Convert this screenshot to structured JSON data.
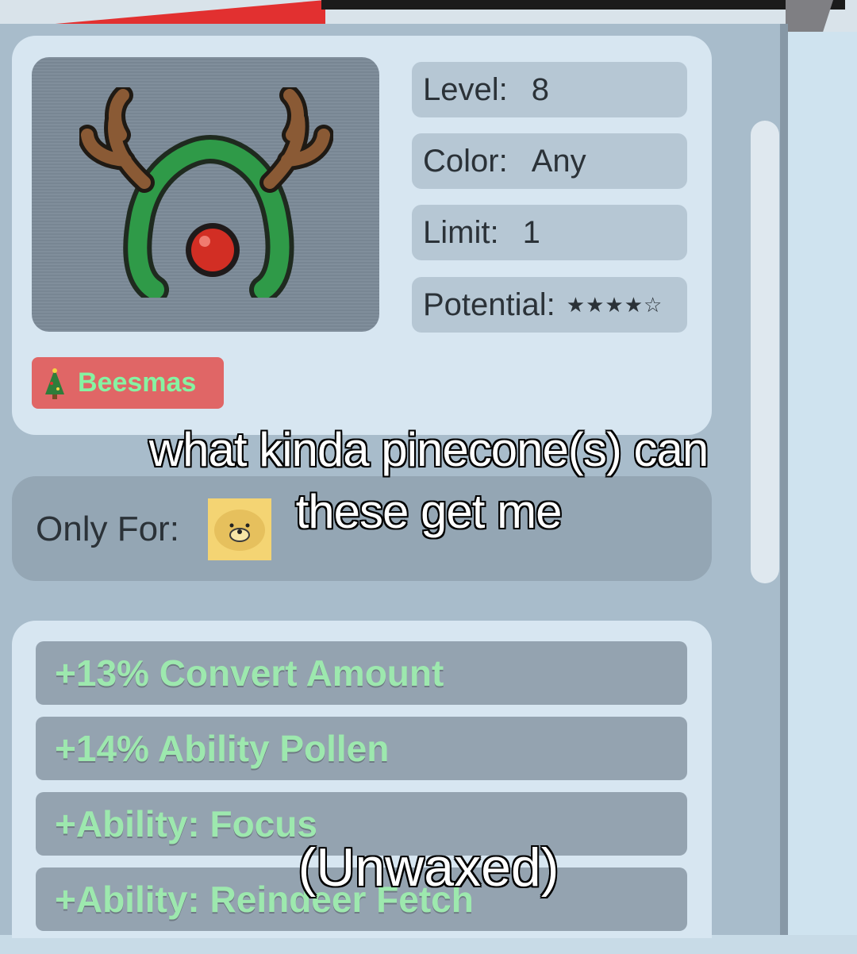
{
  "item": {
    "stats": [
      {
        "label": "Level:",
        "value": "8"
      },
      {
        "label": "Color:",
        "value": "Any"
      },
      {
        "label": "Limit:",
        "value": "1"
      },
      {
        "label": "Potential:",
        "value": "★★★★☆"
      }
    ],
    "potential_stars": 4,
    "potential_max": 5,
    "event_badge": {
      "icon": "christmas-tree-icon",
      "label": "Beesmas",
      "color": "#e06666"
    },
    "only_for": {
      "label": "Only For:",
      "icon": "bear-bee-icon"
    },
    "abilities": [
      "+13% Convert Amount",
      "+14% Ability Pollen",
      "+Ability: Focus",
      "+Ability: Reindeer Fetch"
    ]
  },
  "captions": {
    "main": "what kinda pinecone(s) can these get me",
    "sub": "(Unwaxed)"
  },
  "colors": {
    "ability_text": "#9de8ae",
    "badge_text": "#86f3a2",
    "panel": "#a8bccb"
  }
}
